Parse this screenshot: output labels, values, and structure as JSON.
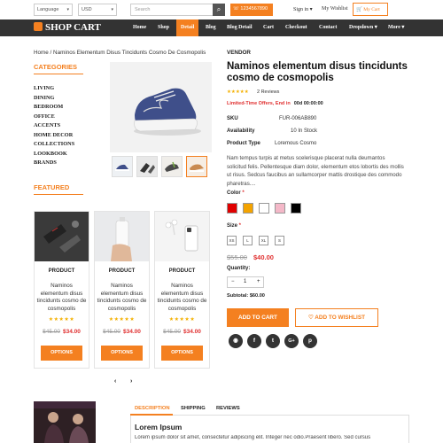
{
  "topbar": {
    "language": "Language",
    "currency": "USD",
    "search_placeholder": "Search",
    "phone": "1234567890",
    "signin": "Sign in",
    "wishlist": "My Wishlist",
    "cart": "My Cart"
  },
  "nav": {
    "brand": "SHOP CART",
    "items": [
      "Home",
      "Shop",
      "Detail",
      "Blog",
      "Blog Detail",
      "Cart",
      "Checkout",
      "Contact",
      "Dropdown",
      "More"
    ]
  },
  "breadcrumb": "Home / Naminos Elementum Disus Tincidunts Cosmo De Cosmopolis",
  "sidebar": {
    "categories_title": "CATEGORIES",
    "categories": [
      "LIVING",
      "DINING",
      "BEDROOM",
      "OFFICE",
      "ACCENTS",
      "HOME DECOR",
      "COLLECTIONS",
      "LOOKBOOK",
      "BRANDS"
    ],
    "featured_title": "FEATURED"
  },
  "featured": [
    {
      "category": "PRODUCT",
      "name": "Naminos elementum disus tincidunts cosmo de cosmopolis",
      "old_price": "$45.00",
      "price": "$34.00",
      "button": "OPTIONS"
    },
    {
      "category": "PRODUCT",
      "name": "Naminos elementum disus tincidunts cosmo de cosmopolis",
      "old_price": "$45.00",
      "price": "$34.00",
      "button": "OPTIONS"
    },
    {
      "category": "PRODUCT",
      "name": "Naminos elementum disus tincidunts cosmo de cosmopolis",
      "old_price": "$45.00",
      "price": "$34.00",
      "button": "OPTIONS"
    }
  ],
  "product": {
    "vendor": "VENDOR",
    "title": "Naminos elementum disus tincidunts cosmo de cosmopolis",
    "rating": 5,
    "reviews": "2 Reviews",
    "offer_label": "Limited-Time Offers, End in",
    "offer_timer": "00d 00:00:00",
    "sku_label": "SKU",
    "sku": "FUR-006AB890",
    "availability_label": "Availability",
    "availability": "10 In Stock",
    "type_label": "Product Type",
    "type": "Loremous Cosmo",
    "description": "Nam tempus turpis at metus scelerisque placerat nulla deumantos solicitud felis. Pellentesque diam dolor, elementum etos lobortis des mollis ut risus. Sedcus faucibus an sullamcorper mattis drostique des commodo pharetras....",
    "color_label": "Color",
    "colors": [
      "#e00000",
      "#f4a300",
      "#ffffff",
      "#f4b8c8",
      "#000000"
    ],
    "size_label": "Size",
    "sizes": [
      "XS",
      "L",
      "XL",
      "S"
    ],
    "old_price": "$55.00",
    "price": "$40.00",
    "qty_label": "Quantity:",
    "qty": "1",
    "subtotal_label": "Subtotal:",
    "subtotal": "$60.00",
    "add_to_cart": "ADD TO CART",
    "add_to_wishlist": "ADD TO WISHLIST",
    "social": [
      "rss-icon",
      "facebook-icon",
      "twitter-icon",
      "google-plus-icon",
      "pinterest-icon"
    ]
  },
  "tabs": {
    "items": [
      "DESCRIPTION",
      "SHIPPING",
      "REVIEWS"
    ],
    "heading": "Lorem Ipsum",
    "text": "Lorem ipsum dolor sit amet, consectetur adipiscing elit. Integer nec odio.Praesent libero. Sed cursus"
  }
}
